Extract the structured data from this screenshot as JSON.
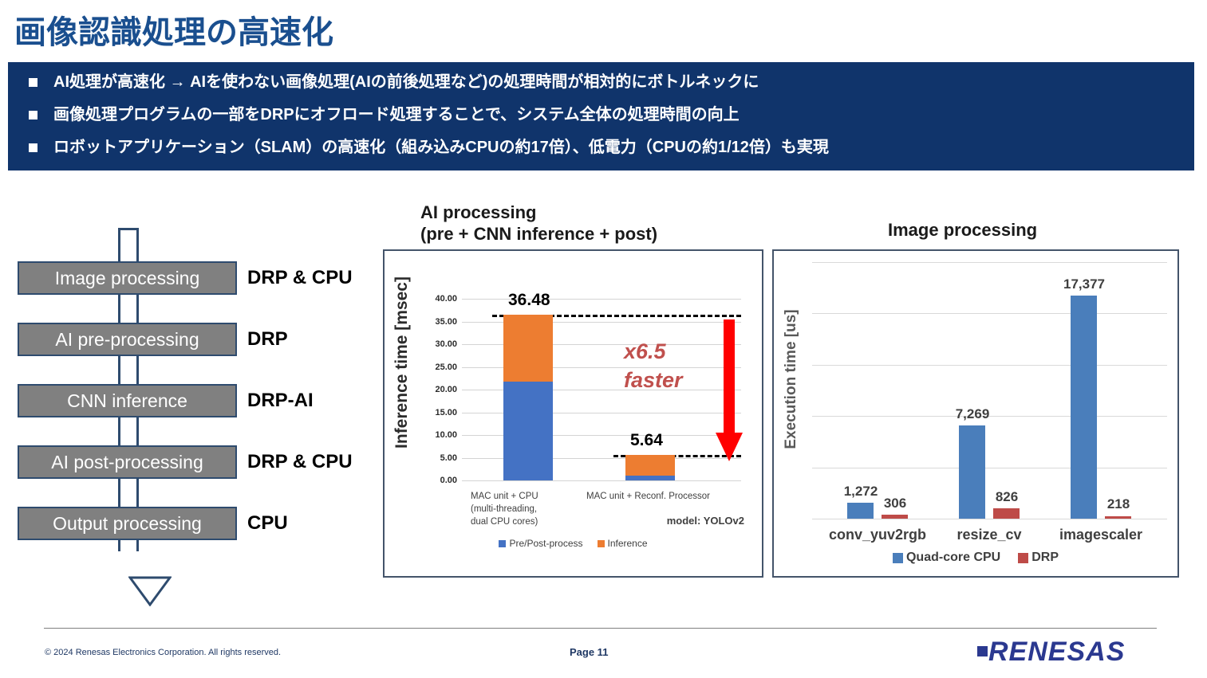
{
  "slide": {
    "title": "画像認識処理の高速化",
    "title_color": "#1a4f8f",
    "banner_color": "#10346b",
    "bullets": [
      "AI処理が高速化 → AIを使わない画像処理(AIの前後処理など)の処理時間が相対的にボトルネックに",
      "画像処理プログラムの一部をDRPにオフロード処理することで、システム全体の処理時間の向上",
      "ロボットアプリケーション（SLAM）の高速化（組み込みCPUの約17倍）、低電力（CPUの約1/12倍）も実現"
    ]
  },
  "flow": {
    "steps": [
      {
        "box": "Image processing",
        "assignment": "DRP & CPU"
      },
      {
        "box": "AI pre-processing",
        "assignment": "DRP"
      },
      {
        "box": "CNN inference",
        "assignment": "DRP-AI"
      },
      {
        "box": "AI post-processing",
        "assignment": "DRP & CPU"
      },
      {
        "box": "Output processing",
        "assignment": "CPU"
      }
    ],
    "box_fill": "#808080",
    "box_border": "#2e4b6e"
  },
  "chart_data": [
    {
      "type": "bar",
      "id": "ai-processing",
      "title": "AI processing\n(pre + CNN inference + post)",
      "title_line1": "AI processing",
      "title_line2": "(pre + CNN inference + post)",
      "stacked": true,
      "xlabel": "",
      "ylabel": "Inference time [msec]",
      "ylim": [
        0,
        40
      ],
      "ytick_labels": [
        "40.00",
        "35.00",
        "30.00",
        "25.00",
        "20.00",
        "15.00",
        "10.00",
        "5.00",
        "0.00"
      ],
      "yticks": [
        40,
        35,
        30,
        25,
        20,
        15,
        10,
        5,
        0
      ],
      "grid": true,
      "legend_position": "bottom",
      "categories": [
        "MAC unit + CPU",
        "MAC unit + Reconf. Processor"
      ],
      "category_sublabels": [
        [
          "MAC unit + CPU",
          "(multi-threading,",
          "dual CPU cores)"
        ],
        [
          "MAC unit + Reconf. Processor"
        ]
      ],
      "series": [
        {
          "name": "Pre/Post-process",
          "color": "#4472c4",
          "values": [
            21.8,
            1.1
          ]
        },
        {
          "name": "Inference",
          "color": "#ed7d31",
          "values": [
            14.68,
            4.54
          ]
        }
      ],
      "totals": [
        36.48,
        5.64
      ],
      "total_labels": [
        "36.48",
        "5.64"
      ],
      "annotations": {
        "speedup": "x6.5",
        "speedup_line2": "faster",
        "speedup_color": "#c0504d",
        "arrow_color": "#ff0000",
        "model": "model: YOLOv2"
      }
    },
    {
      "type": "bar",
      "id": "image-processing",
      "title": "Image processing",
      "xlabel": "",
      "ylabel": "Execution time [us]",
      "ylim": [
        0,
        20000
      ],
      "grid": true,
      "gridline_count": 5,
      "legend_position": "bottom",
      "categories": [
        "conv_yuv2rgb",
        "resize_cv",
        "imagescaler"
      ],
      "series": [
        {
          "name": "Quad-core CPU",
          "color": "#4a7ebb",
          "values": [
            1272,
            7269,
            17377
          ]
        },
        {
          "name": "DRP",
          "color": "#be4b48",
          "values": [
            306,
            826,
            218
          ]
        }
      ],
      "value_labels": {
        "Quad-core CPU": [
          "1,272",
          "7,269",
          "17,377"
        ],
        "DRP": [
          "306",
          "826",
          "218"
        ]
      }
    }
  ],
  "footer": {
    "copyright": "© 2024 Renesas Electronics Corporation. All rights reserved.",
    "page": "Page 11",
    "logo_text": "RENESAS",
    "logo_color": "#2b3990"
  }
}
